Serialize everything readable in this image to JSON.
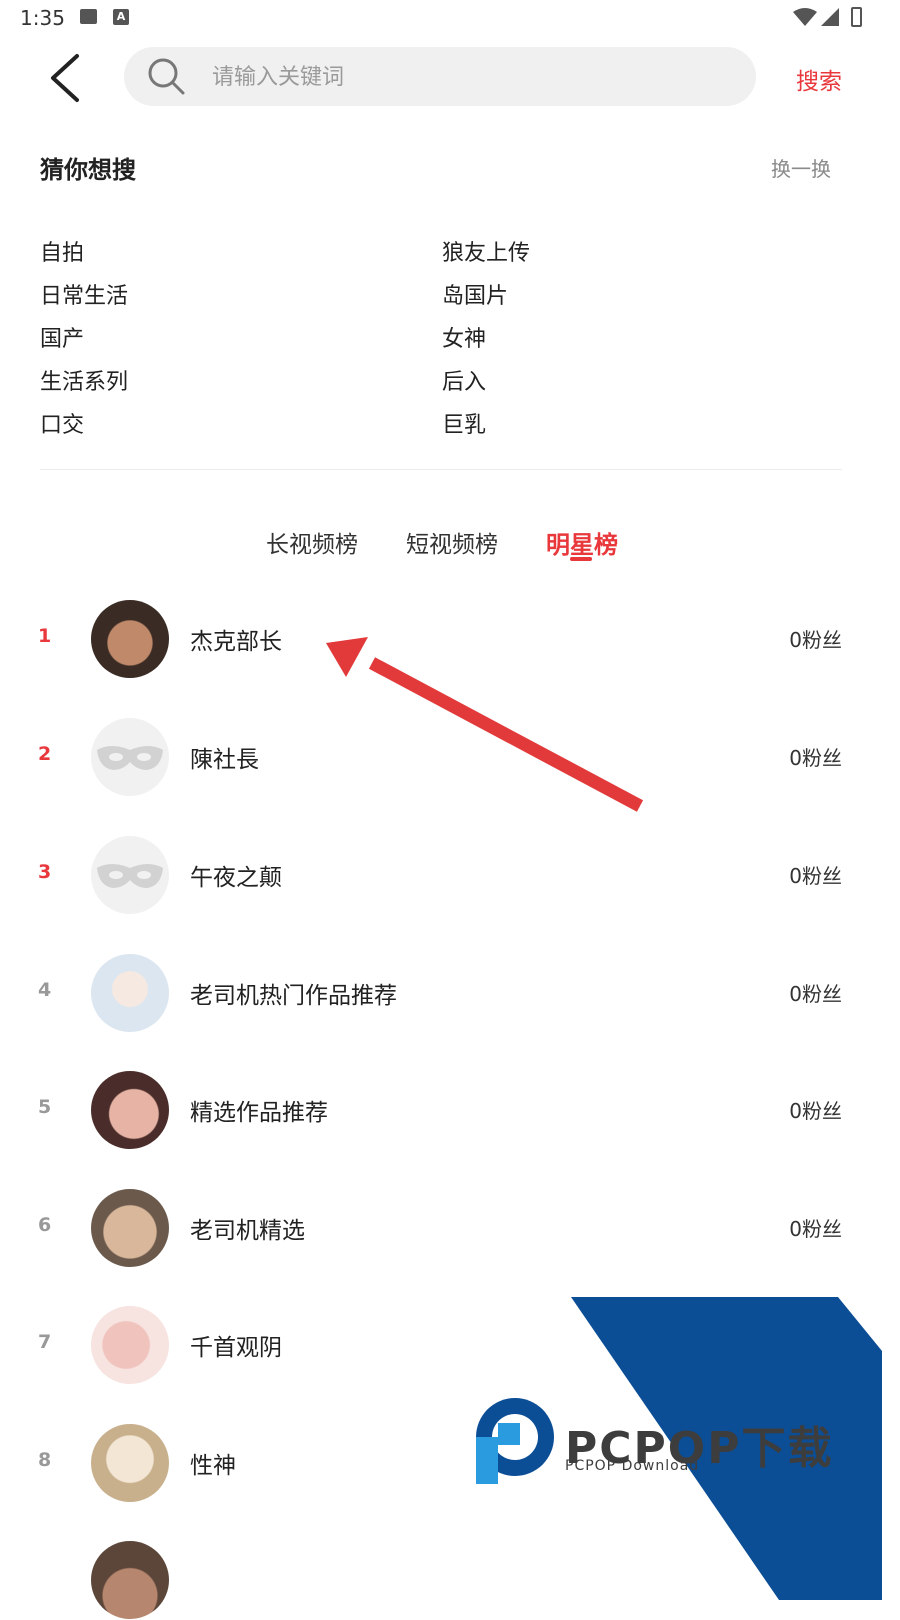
{
  "status_bar": {
    "time": "1:35",
    "icons": [
      "image-icon",
      "a-icon",
      "wifi-icon",
      "signal-icon",
      "battery-icon"
    ]
  },
  "header": {
    "search_placeholder": "请输入关键词",
    "search_button": "搜索",
    "icons": {
      "back": "chevron-left-icon",
      "search": "search-icon"
    }
  },
  "guess": {
    "title": "猜你想搜",
    "refresh_label": "换一换",
    "left_items": [
      "自拍",
      "日常生活",
      "国产",
      "生活系列",
      "口交"
    ],
    "right_items": [
      "狼友上传",
      "岛国片",
      "女神",
      "后入",
      "巨乳"
    ]
  },
  "tabs": [
    {
      "label": "长视频榜",
      "active": false
    },
    {
      "label": "短视频榜",
      "active": false
    },
    {
      "label": "明星榜",
      "active": true
    }
  ],
  "ranking": [
    {
      "rank": "1",
      "name": "杰克部长",
      "fans": "0粉丝"
    },
    {
      "rank": "2",
      "name": "陳社長",
      "fans": "0粉丝"
    },
    {
      "rank": "3",
      "name": "午夜之颠",
      "fans": "0粉丝"
    },
    {
      "rank": "4",
      "name": "老司机热门作品推荐",
      "fans": "0粉丝"
    },
    {
      "rank": "5",
      "name": "精选作品推荐",
      "fans": "0粉丝"
    },
    {
      "rank": "6",
      "name": "老司机精选",
      "fans": "0粉丝"
    },
    {
      "rank": "7",
      "name": "千首观阴",
      "fans": ""
    },
    {
      "rank": "8",
      "name": "性神",
      "fans": ""
    }
  ],
  "watermark": {
    "title": "PCPOP下载",
    "subtitle": "PCPOP Download"
  },
  "colors": {
    "accent": "#e8383c",
    "watermark_blue": "#0b4e96",
    "watermark_light": "#2b9be0"
  }
}
